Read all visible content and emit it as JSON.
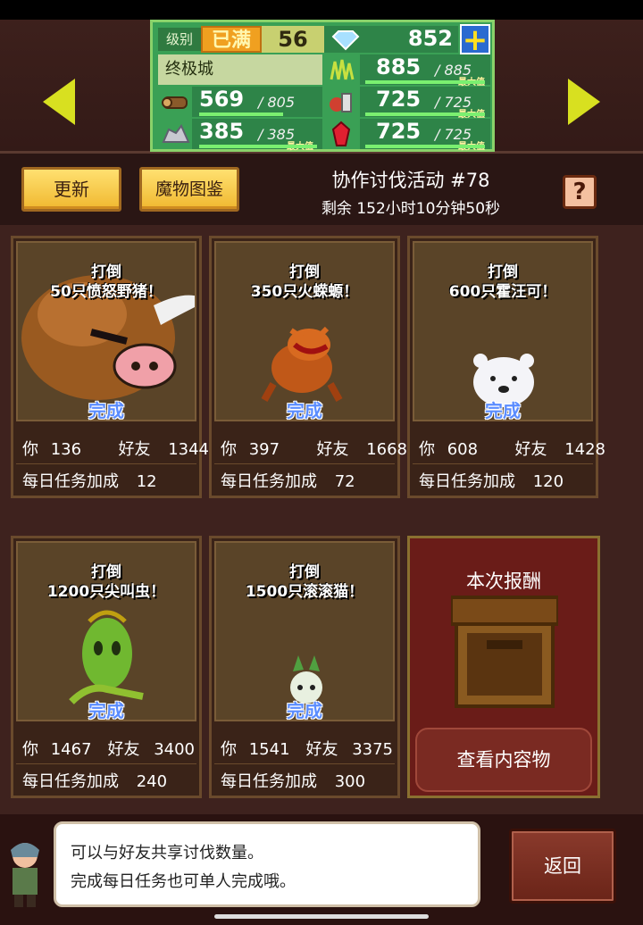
{
  "header": {
    "level_label": "级别",
    "level_max": "已满",
    "level_value": "56",
    "gems": "852",
    "town_name": "终极城",
    "resources": [
      {
        "icon": "wood-icon",
        "current": "569",
        "max": "805"
      },
      {
        "icon": "ore-icon",
        "current": "385",
        "max": "385",
        "max_tag": "最大值"
      },
      {
        "icon": "grass-icon",
        "current": "885",
        "max": "885",
        "max_tag": "最大值"
      },
      {
        "icon": "food-icon",
        "current": "725",
        "max": "725",
        "max_tag": "最大值"
      },
      {
        "icon": "gem-red-icon",
        "current": "725",
        "max": "725",
        "max_tag": "最大值"
      }
    ],
    "resource_fill": {
      "wood": 0.71,
      "ore": 1.0,
      "grass": 1.0,
      "food": 1.0,
      "gem": 1.0
    }
  },
  "toolbar": {
    "refresh_label": "更新",
    "monster_book_label": "魔物图鉴",
    "event_title": "协作讨伐活动 #78",
    "event_remaining": "剩余 152小时10分钟50秒",
    "help_label": "?"
  },
  "cards": [
    {
      "title_1": "打倒",
      "title_2": "50只愤怒野猪！",
      "status": "完成",
      "you_label": "你",
      "you": "136",
      "friend_label": "好友",
      "friend": "1344",
      "daily_label": "每日任务加成",
      "daily": "12",
      "monster": "angry-boar-icon"
    },
    {
      "title_1": "打倒",
      "title_2": "350只火蝾螈！",
      "status": "完成",
      "you_label": "你",
      "you": "397",
      "friend_label": "好友",
      "friend": "1668",
      "daily_label": "每日任务加成",
      "daily": "72",
      "monster": "fire-salamander-icon"
    },
    {
      "title_1": "打倒",
      "title_2": "600只霍汪可！",
      "status": "完成",
      "you_label": "你",
      "you": "608",
      "friend_label": "好友",
      "friend": "1428",
      "daily_label": "每日任务加成",
      "daily": "120",
      "monster": "white-bear-icon"
    },
    {
      "title_1": "打倒",
      "title_2": "1200只尖叫虫！",
      "status": "完成",
      "you_label": "你",
      "you": "1467",
      "friend_label": "好友",
      "friend": "3400",
      "daily_label": "每日任务加成",
      "daily": "240",
      "monster": "screaming-bug-icon"
    },
    {
      "title_1": "打倒",
      "title_2": "1500只滚滚猫！",
      "status": "完成",
      "you_label": "你",
      "you": "1541",
      "friend_label": "好友",
      "friend": "3375",
      "daily_label": "每日任务加成",
      "daily": "300",
      "monster": "rolling-cat-icon"
    }
  ],
  "reward": {
    "title": "本次报酬",
    "view_button": "查看内容物"
  },
  "footer": {
    "tip_line_1": "可以与好友共享讨伐数量。",
    "tip_line_2": "完成每日任务也可单人完成哦。",
    "back_label": "返回"
  }
}
